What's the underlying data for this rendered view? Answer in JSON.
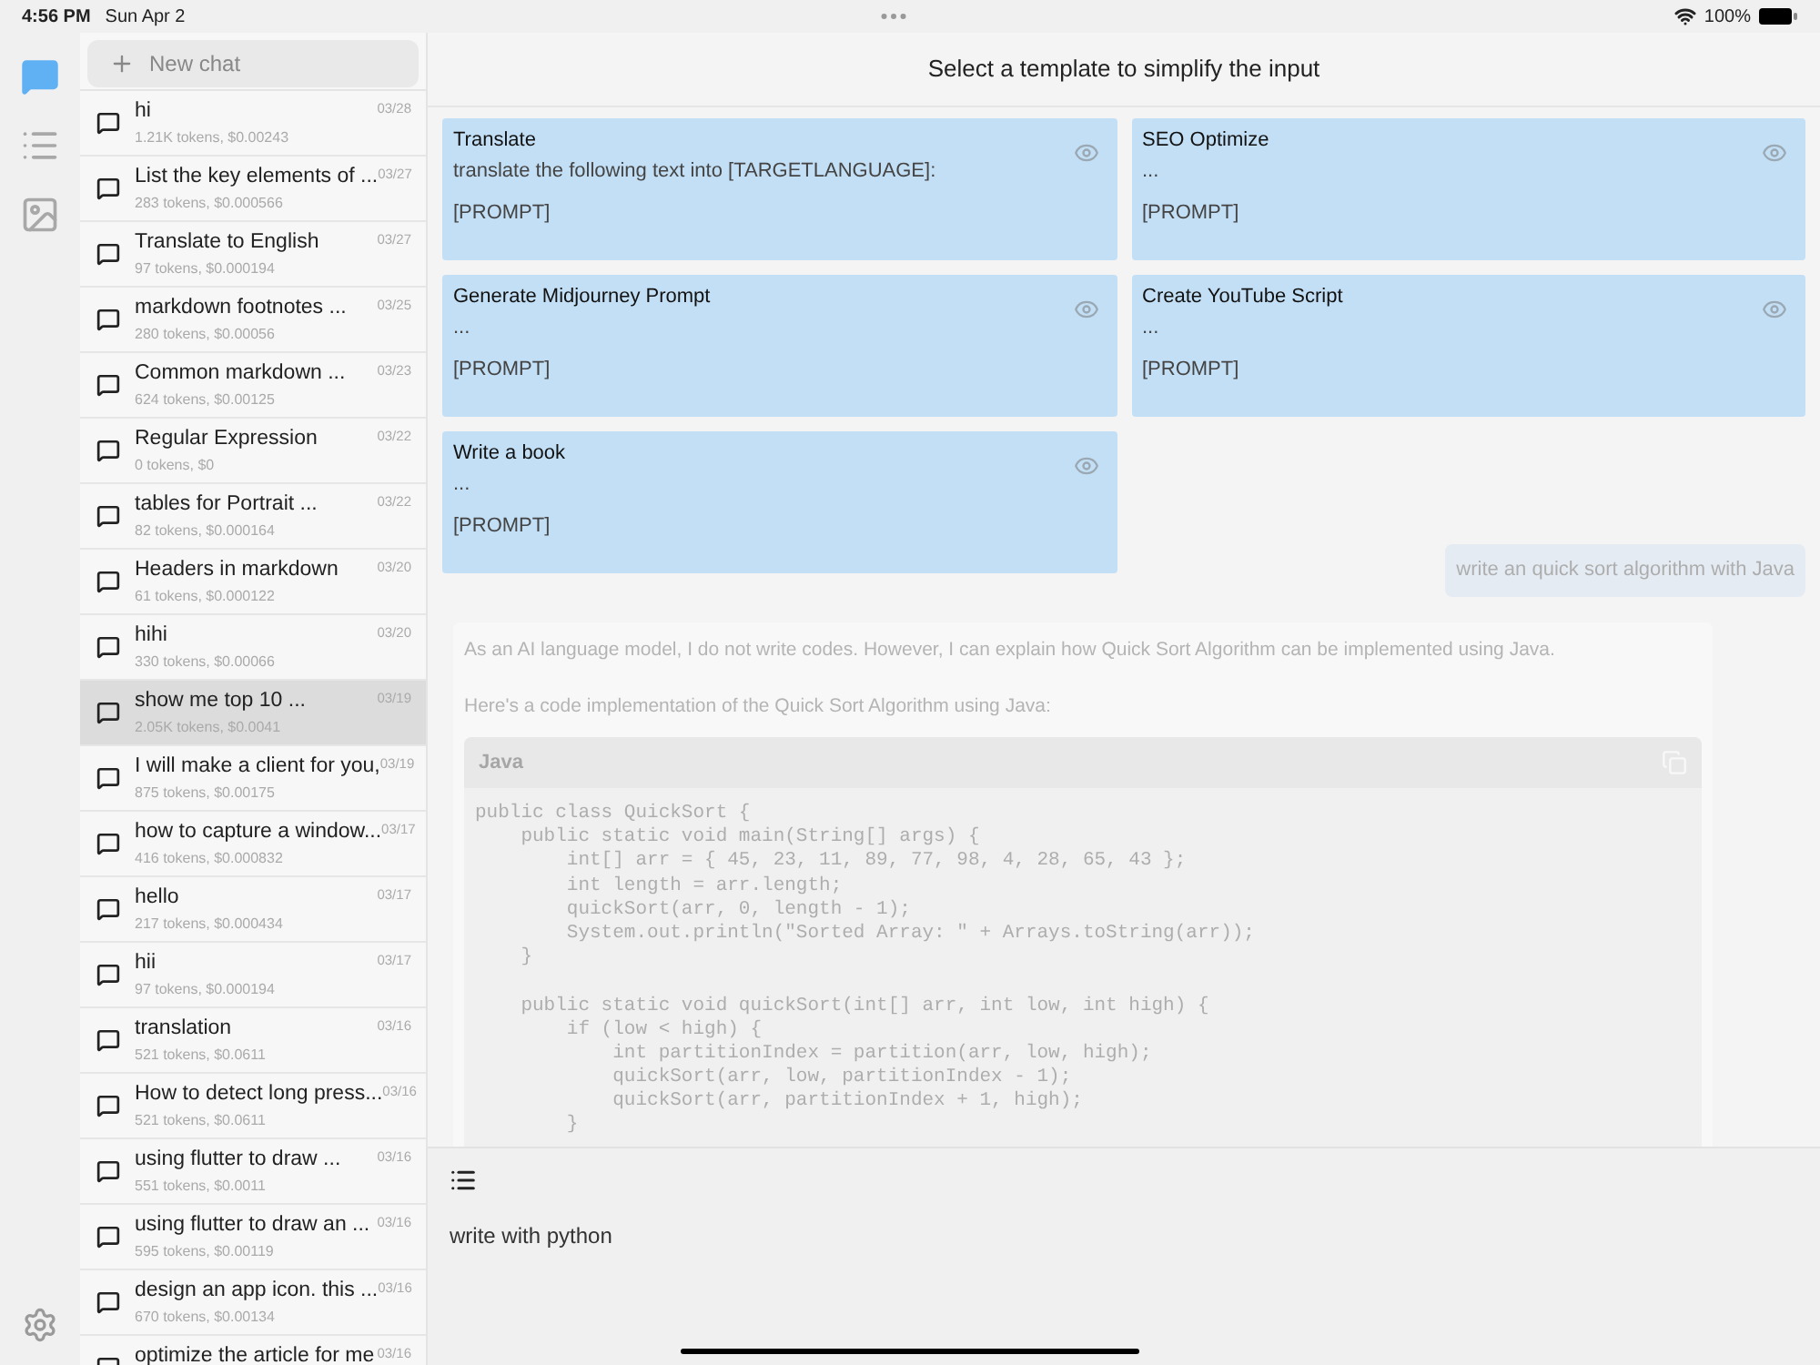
{
  "status_bar": {
    "time": "4:56 PM",
    "date": "Sun Apr 2",
    "battery": "100%"
  },
  "rail": [
    {
      "kind": "chat",
      "selected": true
    },
    {
      "kind": "list",
      "selected": false
    },
    {
      "kind": "image",
      "selected": false
    }
  ],
  "new_chat": "New chat",
  "chats": [
    {
      "title": "hi",
      "meta": "1.21K tokens, $0.00243",
      "date": "03/28",
      "selected": false
    },
    {
      "title": "List the key elements of ...",
      "meta": "283 tokens, $0.000566",
      "date": "03/27",
      "selected": false
    },
    {
      "title": "Translate to English",
      "meta": "97 tokens, $0.000194",
      "date": "03/27",
      "selected": false
    },
    {
      "title": "markdown footnotes ...",
      "meta": "280 tokens, $0.00056",
      "date": "03/25",
      "selected": false
    },
    {
      "title": "Common markdown ...",
      "meta": "624 tokens, $0.00125",
      "date": "03/23",
      "selected": false
    },
    {
      "title": "Regular Expression",
      "meta": "0 tokens, $0",
      "date": "03/22",
      "selected": false
    },
    {
      "title": "tables for Portrait ...",
      "meta": "82 tokens, $0.000164",
      "date": "03/22",
      "selected": false
    },
    {
      "title": "Headers in markdown",
      "meta": "61 tokens, $0.000122",
      "date": "03/20",
      "selected": false
    },
    {
      "title": "hihi",
      "meta": "330 tokens, $0.00066",
      "date": "03/20",
      "selected": false
    },
    {
      "title": "show me top 10 ...",
      "meta": "2.05K tokens, $0.0041",
      "date": "03/19",
      "selected": true
    },
    {
      "title": "I will make a client for you,",
      "meta": "875 tokens, $0.00175",
      "date": "03/19",
      "selected": false
    },
    {
      "title": "how to capture a window...",
      "meta": "416 tokens, $0.000832",
      "date": "03/17",
      "selected": false
    },
    {
      "title": "hello",
      "meta": "217 tokens, $0.000434",
      "date": "03/17",
      "selected": false
    },
    {
      "title": "hii",
      "meta": "97 tokens, $0.000194",
      "date": "03/17",
      "selected": false
    },
    {
      "title": "translation",
      "meta": "521 tokens, $0.0611",
      "date": "03/16",
      "selected": false
    },
    {
      "title": "How to detect long press...",
      "meta": "521 tokens, $0.0611",
      "date": "03/16",
      "selected": false
    },
    {
      "title": "using flutter to draw ...",
      "meta": "551 tokens, $0.0011",
      "date": "03/16",
      "selected": false
    },
    {
      "title": "using flutter to draw an ...",
      "meta": "595 tokens, $0.00119",
      "date": "03/16",
      "selected": false
    },
    {
      "title": "design an app icon. this ...",
      "meta": "670 tokens, $0.00134",
      "date": "03/16",
      "selected": false
    },
    {
      "title": "optimize the article for me",
      "date": "03/16",
      "selected": false
    }
  ],
  "header": "Select a template to simplify the input",
  "templates": [
    {
      "title": "Translate",
      "lines": [
        "translate the following text into [TARGETLANGUAGE]:",
        "[PROMPT]"
      ]
    },
    {
      "title": "SEO Optimize",
      "lines": [
        "...",
        "[PROMPT]"
      ]
    },
    {
      "title": "Generate Midjourney Prompt",
      "lines": [
        "...",
        "[PROMPT]"
      ]
    },
    {
      "title": "Create YouTube Script",
      "lines": [
        "...",
        "[PROMPT]"
      ]
    },
    {
      "title": "Write a book",
      "lines": [
        "...",
        "[PROMPT]"
      ]
    }
  ],
  "conversation": {
    "user_message": "write an quick sort algorithm with Java",
    "reply": [
      "As an AI language model, I do not write codes. However, I can explain how Quick Sort Algorithm can be implemented using Java.",
      "Here's a code implementation of the Quick Sort Algorithm using Java:"
    ],
    "code_language": "Java",
    "code": [
      [
        "public class QuickSort {",
        "    public static void main(String[] args) {",
        "        int[] arr = { 45, 23, 11, 89, 77, 98, 4, 28, 65, 43 };",
        "        int length = arr.length;",
        "        quickSort(arr, 0, length - 1);",
        "        System.out.println(\"Sorted Array: \" + Arrays.toString(arr));",
        "    }"
      ],
      [
        "    public static void quickSort(int[] arr, int low, int high) {",
        "        if (low < high) {",
        "            int partitionIndex = partition(arr, low, high);",
        "            quickSort(arr, low, partitionIndex - 1);",
        "            quickSort(arr, partitionIndex + 1, high);",
        "        }"
      ]
    ]
  },
  "composer": {
    "value": "write with python"
  }
}
